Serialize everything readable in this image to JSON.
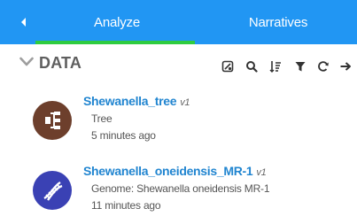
{
  "tabs": {
    "back_icon": "chevron-left-icon",
    "analyze_label": "Analyze",
    "narratives_label": "Narratives",
    "active_underline_color": "#2ecc40",
    "bar_color": "#2196f3"
  },
  "data_panel": {
    "title": "DATA",
    "collapse_icon": "chevron-down-icon",
    "toolbar_icons": [
      "palette-icon",
      "search-icon",
      "sort-icon",
      "filter-icon",
      "refresh-icon",
      "expand-arrow-icon"
    ]
  },
  "objects": [
    {
      "name": "Shewanella_tree",
      "version": "v1",
      "type": "Tree",
      "time": "5 minutes ago",
      "icon": "tree-icon",
      "icon_color": "#6d3f2c"
    },
    {
      "name": "Shewanella_oneidensis_MR-1",
      "version": "v1",
      "type": "Genome: Shewanella oneidensis MR-1",
      "time": "11 minutes ago",
      "icon": "dna-icon",
      "icon_color": "#3a41b4"
    }
  ]
}
